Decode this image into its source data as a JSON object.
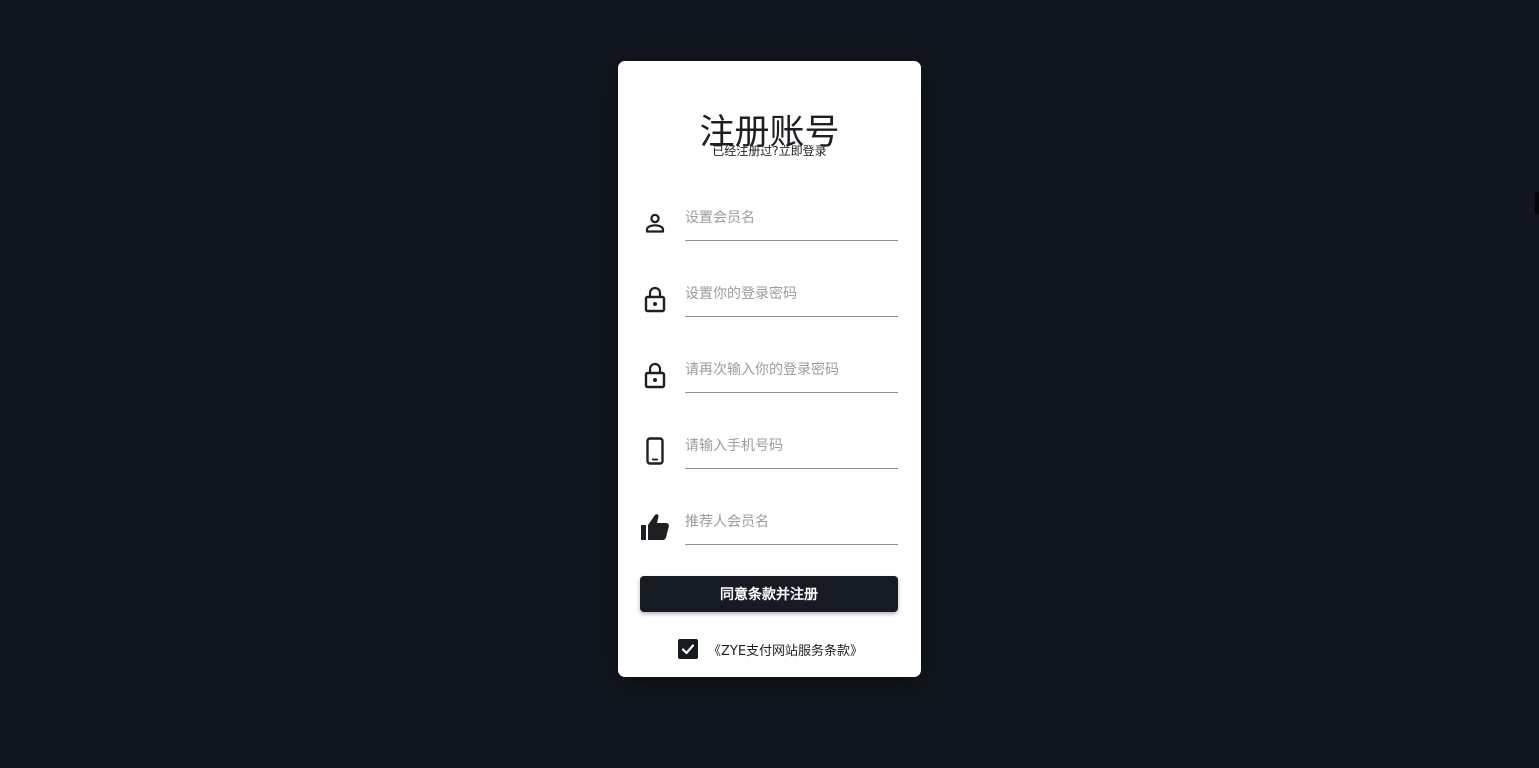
{
  "page": {
    "title": "注册账号",
    "subtitle_prefix": "已经注册过?",
    "login_link": "立即登录"
  },
  "fields": [
    {
      "icon": "person-icon",
      "placeholder": "设置会员名",
      "value": ""
    },
    {
      "icon": "lock-icon",
      "placeholder": "设置你的登录密码",
      "value": ""
    },
    {
      "icon": "lock-icon",
      "placeholder": "请再次输入你的登录密码",
      "value": ""
    },
    {
      "icon": "smartphone-icon",
      "placeholder": "请输入手机号码",
      "value": ""
    },
    {
      "icon": "thumbs-up-icon",
      "placeholder": "推荐人会员名",
      "value": ""
    }
  ],
  "submit_label": "同意条款并注册",
  "terms": {
    "checked": true,
    "label": "《ZYE支付网站服务条款》"
  },
  "colors": {
    "background": "#12171f",
    "card": "#ffffff",
    "accent": "#161a22"
  }
}
